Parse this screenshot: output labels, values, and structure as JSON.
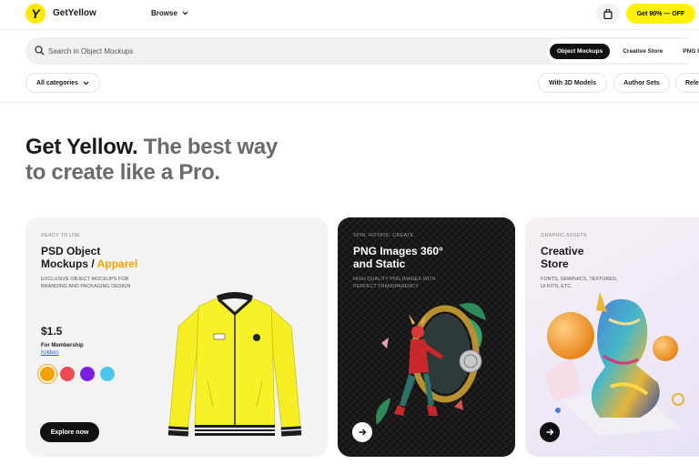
{
  "header": {
    "logo_letter": "Y",
    "brand": "GetYellow",
    "browse_label": "Browse",
    "cta_label": "Get 90% — OFF"
  },
  "search": {
    "placeholder": "Search in Object Mockups",
    "scopes": [
      "Object Mockups",
      "Creative Store",
      "PNG Images"
    ],
    "active_scope": "Object Mockups"
  },
  "filters": {
    "categories_label": "All categories",
    "chips": [
      "With 3D Models",
      "Author Sets",
      "Rele"
    ]
  },
  "hero": {
    "bold": "Get Yellow.",
    "muted_line1": "The best way",
    "muted_line2": "to create like a Pro."
  },
  "cards": [
    {
      "eyebrow": "Ready to use",
      "title_line1": "PSD Object",
      "title_line2_plain": "Mockups / ",
      "title_line2_accent": "Apparel",
      "desc_line1": "Exclusive object mockups for",
      "desc_line2": "branding and packaging design",
      "price": "$1.5",
      "price_note": "For Membership",
      "price_link": "holders",
      "swatches": [
        "#f5a300",
        "#ee4b53",
        "#7d1fe0",
        "#4cc6ea"
      ],
      "button_label": "Explore now"
    },
    {
      "eyebrow": "Spin. Rotate. Create.",
      "title_line1": "PNG Images 360°",
      "title_line2": "and Static",
      "desc_line1": "High quality PNG images with",
      "desc_line2": "perfect transparency"
    },
    {
      "eyebrow": "Graphic assets",
      "title_line1": "Creative",
      "title_line2": "Store",
      "desc_line1": "Fonts, graphics, textures,",
      "desc_line2": "UI kits, etc."
    }
  ],
  "colors": {
    "brand_yellow": "#fff300",
    "accent_orange": "#f5a300",
    "dark": "#111111"
  },
  "icons": [
    "bag-icon",
    "chevron-down-icon",
    "search-icon",
    "arrow-right-icon"
  ]
}
